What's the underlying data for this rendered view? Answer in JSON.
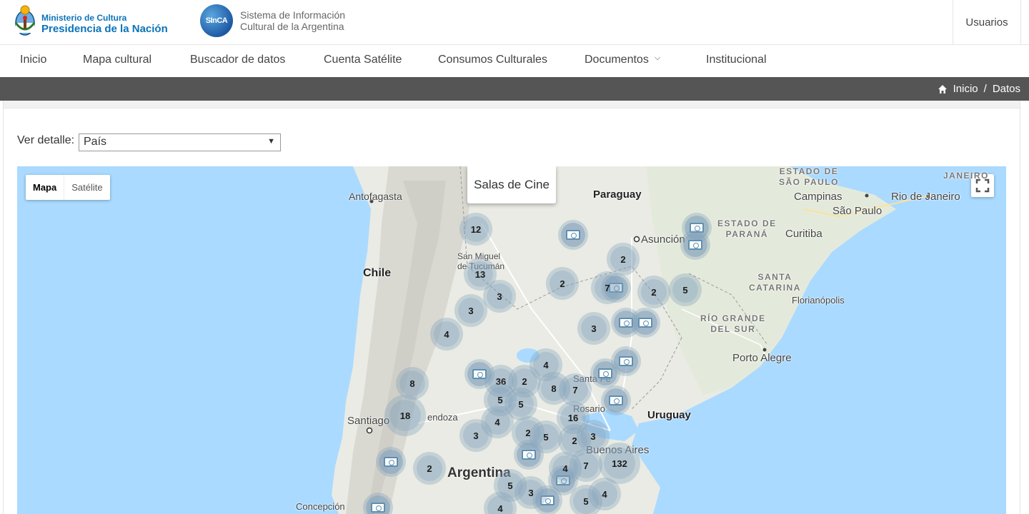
{
  "header": {
    "ministerio_line1": "Ministerio de Cultura",
    "ministerio_line2": "Presidencia de la Nación",
    "sinca_badge": "SInCA",
    "sinca_line1": "Sistema de Información",
    "sinca_line2": "Cultural de la Argentina",
    "usuarios": "Usuarios"
  },
  "nav": {
    "items": [
      "Inicio",
      "Mapa cultural",
      "Buscador de datos",
      "Cuenta Satélite",
      "Consumos Culturales",
      "Documentos",
      "Institucional"
    ]
  },
  "breadcrumb": {
    "home": "Inicio",
    "separator": "/",
    "current": "Datos"
  },
  "filter": {
    "label": "Ver detalle:",
    "selected": "País"
  },
  "map": {
    "type_map": "Mapa",
    "type_satellite": "Satélite",
    "info_title": "Salas de Cine",
    "places": {
      "antofagasta": "Antofagasta",
      "paraguay": "Paraguay",
      "asuncion": "Asunción",
      "chile": "Chile",
      "san_miguel": "San Miguel",
      "tucuman": "de Tucumán",
      "campinas": "Campinas",
      "sao_paulo": "São Paulo",
      "rio": "Rio de Janeiro",
      "curitiba": "Curitiba",
      "florianopolis": "Florianópolis",
      "porto_alegre": "Porto Alegre",
      "uruguay": "Uruguay",
      "santiago": "Santiago",
      "mendoza": "endoza",
      "santa_fe": "Santa Fe",
      "rosario": "Rosario",
      "buenos_aires": "Buenos Aires",
      "argentina": "Argentina",
      "concepcion": "Concepción",
      "estado_sp_1": "ESTADO DE",
      "estado_sp_2": "SÃO PAULO",
      "janeiro": "JANEIRO",
      "parana_1": "ESTADO DE",
      "parana_2": "PARANÁ",
      "santa_catarina_1": "SANTA",
      "santa_catarina_2": "CATARINA",
      "rgs_1": "RÍO GRANDE",
      "rgs_2": "DEL SUR"
    },
    "clusters": [
      "12",
      "13",
      "3",
      "3",
      "4",
      "2",
      "2",
      "7",
      "2",
      "5",
      "3",
      "4",
      "36",
      "2",
      "8",
      "7",
      "5",
      "5",
      "16",
      "18",
      "8",
      "4",
      "3",
      "2",
      "5",
      "2",
      "3",
      "132",
      "4",
      "7",
      "2",
      "5",
      "3",
      "4",
      "5",
      "4"
    ]
  }
}
